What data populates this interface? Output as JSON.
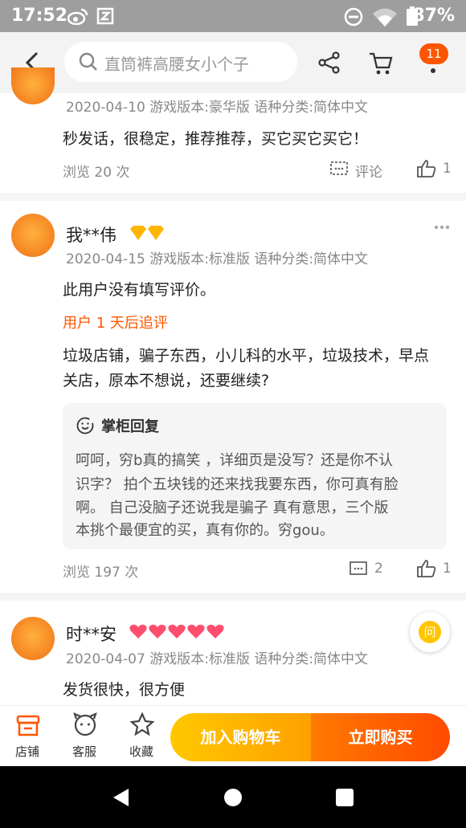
{
  "status_bar": {
    "time": "17:52",
    "battery": "87%"
  },
  "nav": {
    "search_placeholder": "直筒裤高腰女小个子",
    "cart_badge": "11"
  },
  "reviews": [
    {
      "date_meta": "2020-04-10 游戏版本:豪华版 语种分类:简体中文",
      "content": "秒发话，很稳定，推荐推荐，买它买它买它！",
      "views": "浏览 20 次",
      "comment_label": "评论",
      "likes": "1"
    },
    {
      "username": "我**伟",
      "date_meta": "2020-04-15 游戏版本:标准版 语种分类:简体中文",
      "content": "此用户没有填写评价。",
      "followup_label": "用户 1 天后追评",
      "followup_lines": [
        "垃圾店铺，骗子东西，小儿科的水平，垃圾技术，早点",
        "关店，原本不想说，还要继续?"
      ],
      "reply_title": "掌柜回复",
      "reply_lines": [
        "呵呵，穷b真的搞笑 ，详细页是没写？还是你不认",
        "识字？  拍个五块钱的还来找我要东西，你可真有脸",
        "啊。  自己没脑子还说我是骗子 真有意思，三个版",
        "本挑个最便宜的买，真有你的。穷gou。"
      ],
      "views": "浏览 197 次",
      "comments": "2",
      "likes": "1"
    },
    {
      "username": "时**安",
      "date_meta": "2020-04-07 游戏版本:标准版 语种分类:简体中文",
      "content": "发货很快，很方便"
    }
  ],
  "float_button": "问",
  "bottom_bar": {
    "store": "店铺",
    "service": "客服",
    "favorite": "收藏",
    "add_to_cart": "加入购物车",
    "buy_now": "立即购买"
  },
  "colors": {
    "accent": "#ff5500",
    "cart_button": "#ffb400",
    "buy_button": "#ff5500"
  }
}
